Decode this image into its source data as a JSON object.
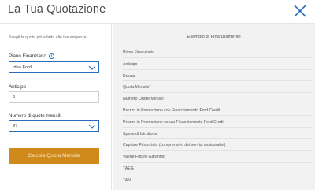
{
  "header": {
    "title": "La Tua Quotazione"
  },
  "form": {
    "intro": "Scegli la quota più adatta alle tue esigenze",
    "piano": {
      "label": "Piano Finanziario",
      "value": "Idea Ford"
    },
    "anticipo": {
      "label": "Anticipo",
      "value": "0"
    },
    "quote": {
      "label": "Numero di quote mensili",
      "value": "37"
    },
    "cta_label": "Calcola Quota Mensile"
  },
  "panel": {
    "title": "Esempio di Finanziamento",
    "rows": [
      "Piano Finanziario",
      "Anticipo",
      "Durata",
      "Quota Mensile*",
      "Numero Quote Mensili",
      "Prezzo in Promozione con Finanziamento Ford Credit",
      "Prezzo in Promozione senza Finanziamento Ford Credit",
      "Spese di Istruttoria",
      "Capitale Finanziato (comprensivo dei servizi assicurativi)",
      "Valore Futuro Garantito",
      "TAEG",
      "TAN"
    ]
  },
  "colors": {
    "accent": "#2a6ebb",
    "cta": "#d08a1c",
    "panel_bg": "#f2f2f2"
  }
}
